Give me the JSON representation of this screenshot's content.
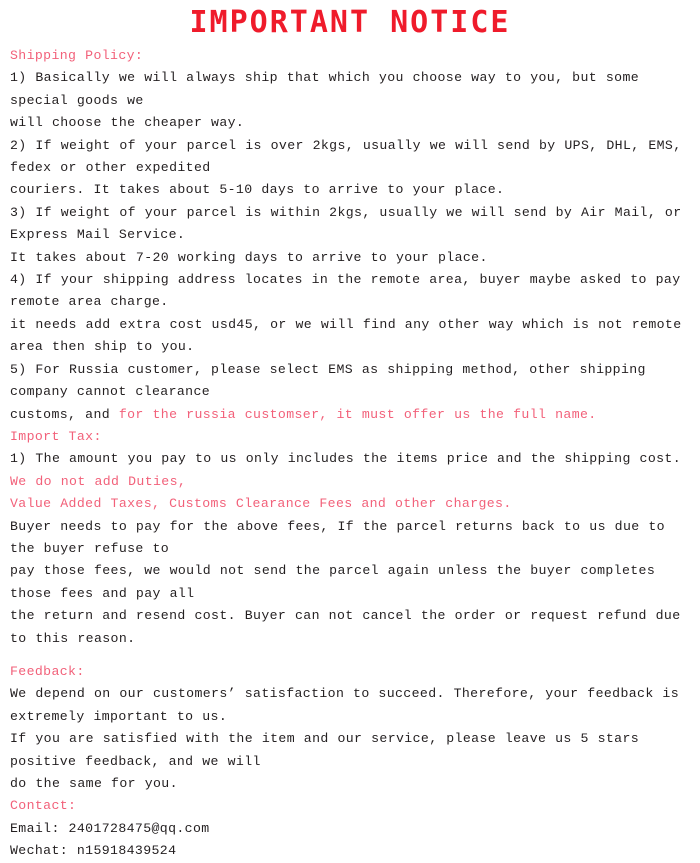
{
  "document": {
    "title": "IMPORTANT NOTICE",
    "colors": {
      "title_red": "#ef1b2b",
      "accent_red": "#f2617a",
      "body_text": "#231f20",
      "background": "#ffffff"
    },
    "sections": [
      {
        "heading": "Shipping Policy:",
        "lines": [
          [
            {
              "text": "1) Basically we will always ship that which you choose way to you, but some special goods we",
              "color": "black"
            }
          ],
          [
            {
              "text": "will choose the cheaper way.",
              "color": "black"
            }
          ],
          [
            {
              "text": "2) If weight of your parcel is over 2kgs, usually we will send by UPS, DHL, EMS, fedex or other expedited",
              "color": "black"
            }
          ],
          [
            {
              "text": "couriers. It takes about 5-10 days to arrive to your place.",
              "color": "black"
            }
          ],
          [
            {
              "text": "3) If weight of your parcel is within 2kgs, usually we will send by Air Mail, or Express Mail Service.",
              "color": "black"
            }
          ],
          [
            {
              "text": "It takes about 7-20 working days to arrive to your place.",
              "color": "black"
            }
          ],
          [
            {
              "text": "4) If your shipping address locates in the remote area, buyer maybe asked to pay remote area charge.",
              "color": "black"
            }
          ],
          [
            {
              "text": "it needs add extra cost usd45, or we will find any other way which is not remote area then ship to you.",
              "color": "black"
            }
          ],
          [
            {
              "text": "5) For Russia customer, please select EMS as shipping method, other shipping company cannot clearance",
              "color": "black"
            }
          ],
          [
            {
              "text": "customs, and ",
              "color": "black"
            },
            {
              "text": "for the russia customser, it must offer us the full name.",
              "color": "red"
            }
          ]
        ]
      },
      {
        "heading": "Import Tax:",
        "lines": [
          [
            {
              "text": "1) The amount you pay to us only includes the items price and the shipping cost. ",
              "color": "black"
            },
            {
              "text": "We do not add Duties,",
              "color": "red"
            }
          ],
          [
            {
              "text": "Value Added Taxes, Customs Clearance Fees and other charges.",
              "color": "red"
            }
          ],
          [
            {
              "text": "Buyer needs to pay for the above fees, If the parcel returns back to us due to the buyer refuse to",
              "color": "black"
            }
          ],
          [
            {
              "text": "pay those fees, we would not send the parcel again unless the buyer completes those fees and pay all",
              "color": "black"
            }
          ],
          [
            {
              "text": "the return and resend cost. Buyer can not cancel the order or request refund due to this reason.",
              "color": "black"
            }
          ]
        ]
      },
      {
        "heading": "Feedback:",
        "spacer_before": true,
        "lines": [
          [
            {
              "text": "We depend on our customers’ satisfaction to succeed. Therefore, your feedback is extremely important to us.",
              "color": "black"
            }
          ],
          [
            {
              "text": "If you are satisfied with the item and our service, please leave us 5 stars positive feedback, and we will",
              "color": "black"
            }
          ],
          [
            {
              "text": "do the same for you.",
              "color": "black"
            }
          ]
        ]
      },
      {
        "heading": "Contact:",
        "lines": [
          [
            {
              "text": "Email: 2401728475@qq.com",
              "color": "black"
            }
          ],
          [
            {
              "text": "Wechat: n15918439524",
              "color": "black"
            }
          ]
        ]
      }
    ]
  }
}
